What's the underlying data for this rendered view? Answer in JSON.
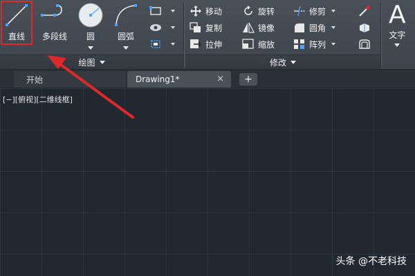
{
  "ribbon": {
    "draw_panel": {
      "title": "绘图",
      "tools": {
        "line": "直线",
        "polyline": "多段线",
        "circle": "圆",
        "arc": "圆弧"
      }
    },
    "modify_panel": {
      "title": "修改",
      "tools": {
        "move": "移动",
        "rotate": "旋转",
        "trim": "修剪",
        "copy": "复制",
        "mirror": "镜像",
        "fillet": "圆角",
        "stretch": "拉伸",
        "scale": "缩放",
        "array": "阵列"
      }
    },
    "text_panel": {
      "glyph": "A",
      "label": "文字"
    }
  },
  "tabs": {
    "start": "开始",
    "drawing": "Drawing1*",
    "close": "×",
    "add": "+"
  },
  "viewport": {
    "label": "[−][俯视][二维线框]"
  },
  "watermark": "头条 @不老科技",
  "colors": {
    "highlight": "#e0282a",
    "arrow": "#e0282a",
    "canvas": "#212830",
    "ribbon": "#454b52"
  }
}
